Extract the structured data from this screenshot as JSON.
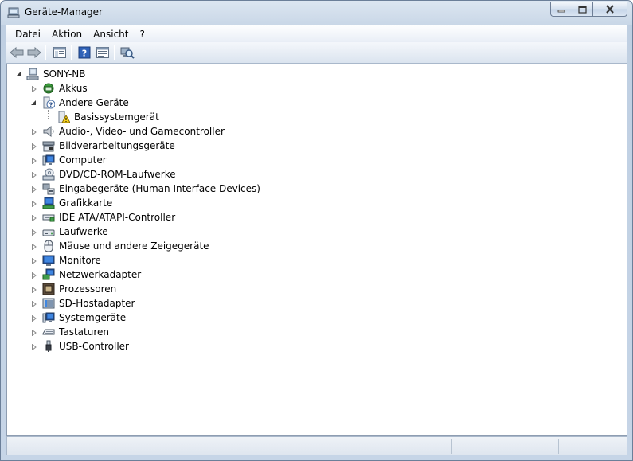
{
  "window": {
    "title": "Geräte-Manager",
    "accent": "#c6d5e7"
  },
  "menu": {
    "items": [
      "Datei",
      "Aktion",
      "Ansicht",
      "?"
    ]
  },
  "toolbar": {
    "buttons": [
      "back-arrow-icon",
      "forward-arrow-icon",
      "show-hide-console-tree-icon",
      "help-icon",
      "properties-icon",
      "scan-hardware-icon"
    ]
  },
  "tree": {
    "root": "SONY-NB",
    "nodes": [
      {
        "label": "Akkus",
        "icon": "battery-icon"
      },
      {
        "label": "Andere Geräte",
        "icon": "unknown-device-icon",
        "expanded": true,
        "children": [
          {
            "label": "Basissystemgerät",
            "icon": "warning-device-icon"
          }
        ]
      },
      {
        "label": "Audio-, Video- und Gamecontroller",
        "icon": "speaker-icon"
      },
      {
        "label": "Bildverarbeitungsgeräte",
        "icon": "camera-icon"
      },
      {
        "label": "Computer",
        "icon": "computer-icon"
      },
      {
        "label": "DVD/CD-ROM-Laufwerke",
        "icon": "dvd-drive-icon"
      },
      {
        "label": "Eingabegeräte (Human Interface Devices)",
        "icon": "hid-icon"
      },
      {
        "label": "Grafikkarte",
        "icon": "display-adapter-icon"
      },
      {
        "label": "IDE ATA/ATAPI-Controller",
        "icon": "ide-controller-icon"
      },
      {
        "label": "Laufwerke",
        "icon": "disk-drive-icon"
      },
      {
        "label": "Mäuse und andere Zeigegeräte",
        "icon": "mouse-icon"
      },
      {
        "label": "Monitore",
        "icon": "monitor-icon"
      },
      {
        "label": "Netzwerkadapter",
        "icon": "network-adapter-icon"
      },
      {
        "label": "Prozessoren",
        "icon": "processor-icon"
      },
      {
        "label": "SD-Hostadapter",
        "icon": "sd-host-icon"
      },
      {
        "label": "Systemgeräte",
        "icon": "system-device-icon"
      },
      {
        "label": "Tastaturen",
        "icon": "keyboard-icon"
      },
      {
        "label": "USB-Controller",
        "icon": "usb-icon"
      }
    ]
  }
}
